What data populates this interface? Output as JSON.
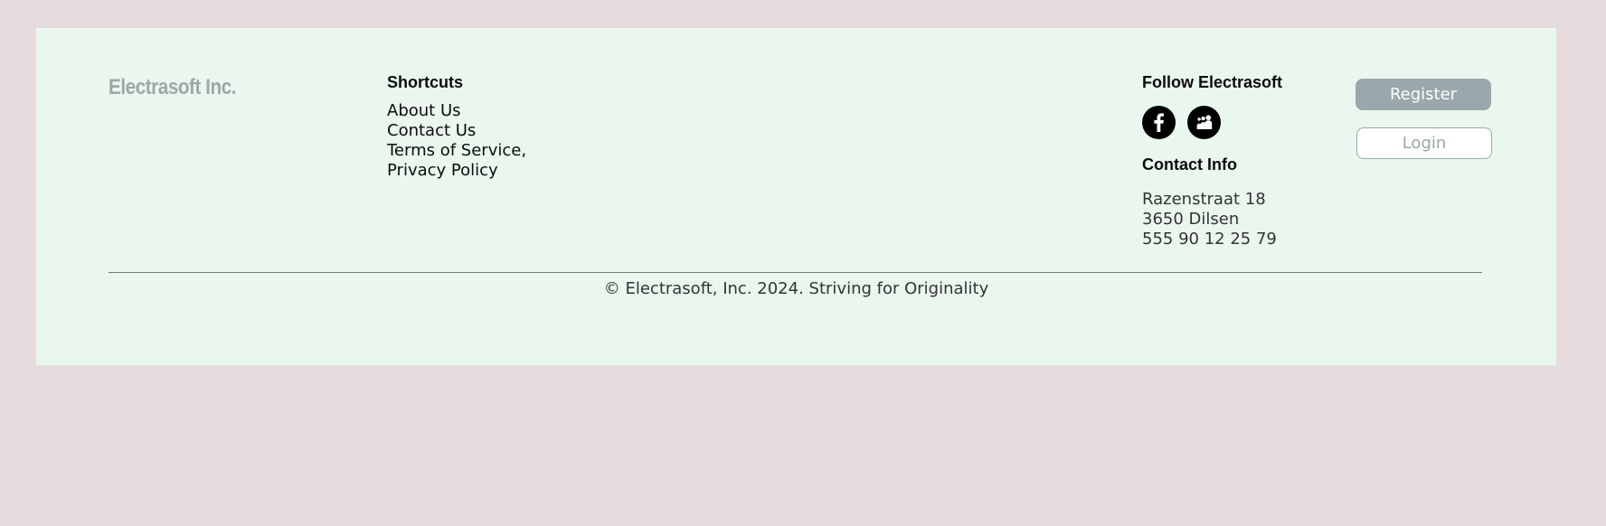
{
  "brand": {
    "name": "Electrasoft Inc."
  },
  "shortcuts": {
    "title": "Shortcuts",
    "links": [
      "About Us",
      "Contact Us",
      "Terms of Service,",
      "Privacy Policy"
    ]
  },
  "follow": {
    "title": "Follow Electrasoft",
    "icons": [
      "facebook-icon",
      "myspace-icon"
    ]
  },
  "contact": {
    "title": "Contact Info",
    "lines": [
      "Razenstraat 18",
      "3650 Dilsen",
      "555 90 12 25 79"
    ]
  },
  "auth": {
    "register_label": "Register",
    "login_label": "Login"
  },
  "footer": {
    "copyright": "© Electrasoft, Inc. 2024. Striving for Originality"
  },
  "colors": {
    "page_bg": "#e7dcdd",
    "footer_bg": "#eaf7ef",
    "accent_gray": "#9aa7ab"
  }
}
